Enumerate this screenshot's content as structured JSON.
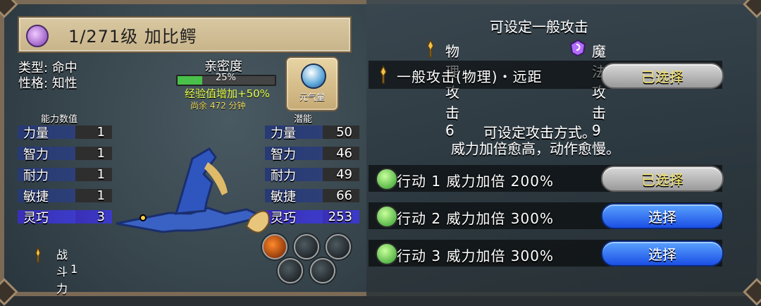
{
  "title": {
    "text": "1/271级 加比鳄"
  },
  "info": {
    "type_label": "类型: 命中",
    "personality_label": "性格: 知性"
  },
  "intimacy": {
    "label": "亲密度",
    "percent_text": "25%",
    "percent_value": 0.25,
    "exp_bonus": "经验值增加+50%",
    "remaining": "尚余 472 分钟"
  },
  "energy": {
    "label": "元气量"
  },
  "stats": {
    "ability_title": "能力数值",
    "potential_title": "潜能",
    "ability": [
      {
        "name": "力量",
        "value": "1"
      },
      {
        "name": "智力",
        "value": "1"
      },
      {
        "name": "耐力",
        "value": "1"
      },
      {
        "name": "敏捷",
        "value": "1"
      },
      {
        "name": "灵巧",
        "value": "3"
      }
    ],
    "potential": [
      {
        "name": "力量",
        "value": "50"
      },
      {
        "name": "智力",
        "value": "46"
      },
      {
        "name": "耐力",
        "value": "49"
      },
      {
        "name": "敏捷",
        "value": "66"
      },
      {
        "name": "灵巧",
        "value": "253"
      }
    ]
  },
  "combat_power": {
    "label": "战斗力",
    "value": "1"
  },
  "attack": {
    "header": "可设定一般攻击",
    "physical": "物理攻击6",
    "magic": "魔法攻击9",
    "row_text": "一般攻击(物理)・远距",
    "selected_label": "已选择"
  },
  "action_method": {
    "title_line1": "可设定攻击方式。",
    "title_line2": "威力加倍愈高，动作愈慢。",
    "rows": [
      {
        "text": "行动 1 威力加倍 200%",
        "button": "已选择"
      },
      {
        "text": "行动 2 威力加倍 300%",
        "button": "选择"
      },
      {
        "text": "行动 3 威力加倍 300%",
        "button": "选择"
      }
    ]
  },
  "colors": {
    "selected_text": "#f0de63",
    "blue_button": "#1b4fe5"
  }
}
